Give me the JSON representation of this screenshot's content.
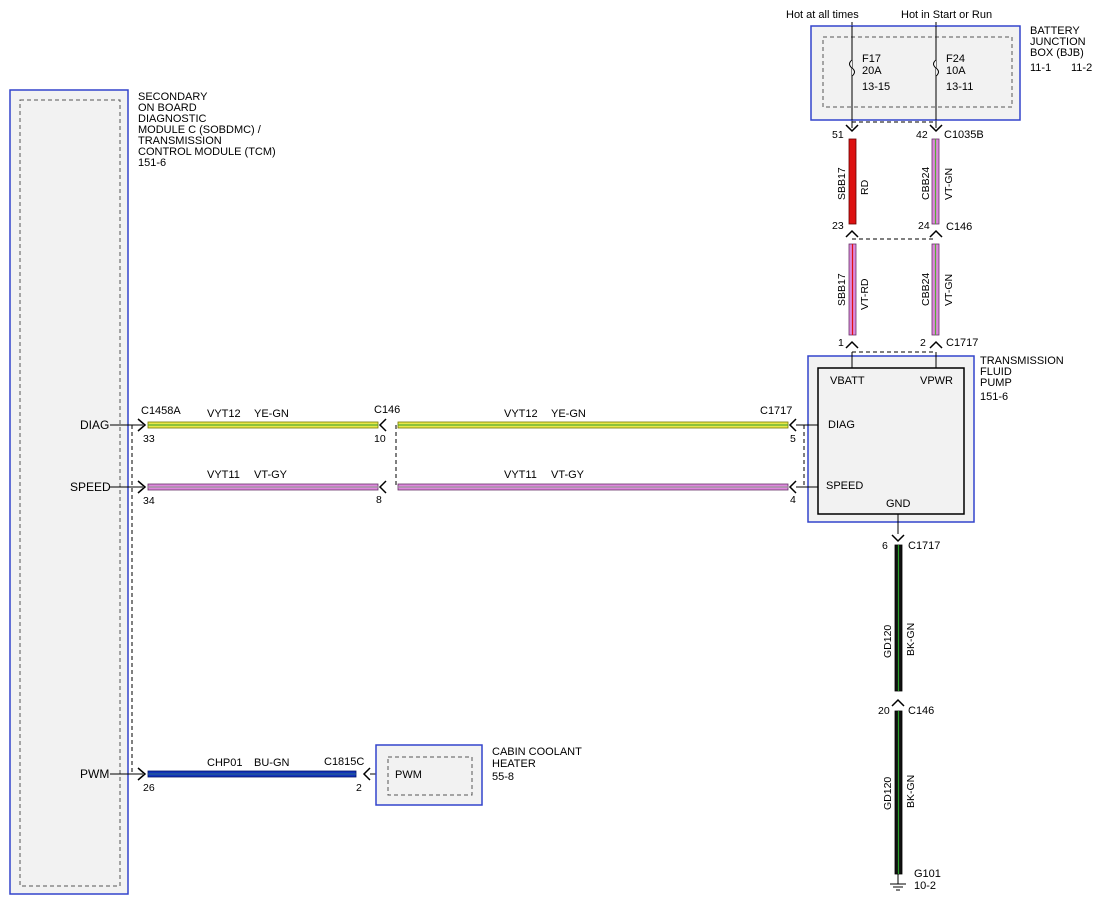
{
  "diagram": {
    "tcm": {
      "title_lines": [
        "SECONDARY",
        "ON BOARD",
        "DIAGNOSTIC",
        "MODULE C (SOBDMC) /",
        "TRANSMISSION",
        "CONTROL MODULE (TCM)",
        "151-6"
      ],
      "pins": {
        "diag": "DIAG",
        "speed": "SPEED",
        "pwm": "PWM"
      },
      "connector": "C1458A",
      "pin_numbers": {
        "diag": "33",
        "speed": "34",
        "pwm": "26"
      }
    },
    "sources": {
      "hot_all_times": "Hot at all times",
      "hot_start_run": "Hot in Start or Run"
    },
    "bjb": {
      "title_lines": [
        "BATTERY",
        "JUNCTION",
        "BOX (BJB)",
        "11-1",
        "11-2"
      ],
      "fuse1": {
        "name": "F17",
        "rating": "20A",
        "ref": "13-15"
      },
      "fuse2": {
        "name": "F24",
        "rating": "10A",
        "ref": "13-11"
      },
      "connector": "C1035B",
      "pin_left": "51",
      "pin_right": "42"
    },
    "c146": {
      "label": "C146",
      "pins_power": {
        "left": "23",
        "right": "24"
      },
      "pins_signal": {
        "diag": "10",
        "speed": "8"
      },
      "pin_ground": "20"
    },
    "c1717": {
      "label": "C1717",
      "pins_power": {
        "left": "1",
        "right": "2"
      },
      "pins_signal": {
        "diag": "5",
        "speed": "4"
      },
      "pin_ground": "6"
    },
    "pump": {
      "title_lines": [
        "TRANSMISSION",
        "FLUID",
        "PUMP",
        "151-6"
      ],
      "pins": {
        "vbatt": "VBATT",
        "vpwr": "VPWR",
        "diag": "DIAG",
        "speed": "SPEED",
        "gnd": "GND"
      }
    },
    "heater": {
      "title_lines": [
        "CABIN COOLANT",
        "HEATER",
        "55-8"
      ],
      "pin": "PWM",
      "connector": "C1815C",
      "pin_number": "2"
    },
    "wires": {
      "sbb17_upper": {
        "circuit": "SBB17",
        "color": "RD"
      },
      "cbb24_upper": {
        "circuit": "CBB24",
        "color": "VT-GN"
      },
      "sbb17_lower": {
        "circuit": "SBB17",
        "color": "VT-RD"
      },
      "cbb24_lower": {
        "circuit": "CBB24",
        "color": "VT-GN"
      },
      "diag_left": {
        "circuit": "VYT12",
        "color": "YE-GN"
      },
      "diag_right": {
        "circuit": "VYT12",
        "color": "YE-GN"
      },
      "speed_left": {
        "circuit": "VYT11",
        "color": "VT-GY"
      },
      "speed_right": {
        "circuit": "VYT11",
        "color": "VT-GY"
      },
      "pwm": {
        "circuit": "CHP01",
        "color": "BU-GN"
      },
      "gnd_upper": {
        "circuit": "GD120",
        "color": "BK-GN"
      },
      "gnd_lower": {
        "circuit": "GD120",
        "color": "BK-GN"
      }
    },
    "ground": {
      "label": "G101",
      "ref": "10-2"
    },
    "colors": {
      "module_border": "#3344cc",
      "red": "#dd1111",
      "violet": "#dd88dd",
      "yellow": "#e8e84a",
      "green_stripe": "#55aa33",
      "blue": "#1133bb",
      "black": "#111111",
      "dark_green": "#117711"
    }
  }
}
